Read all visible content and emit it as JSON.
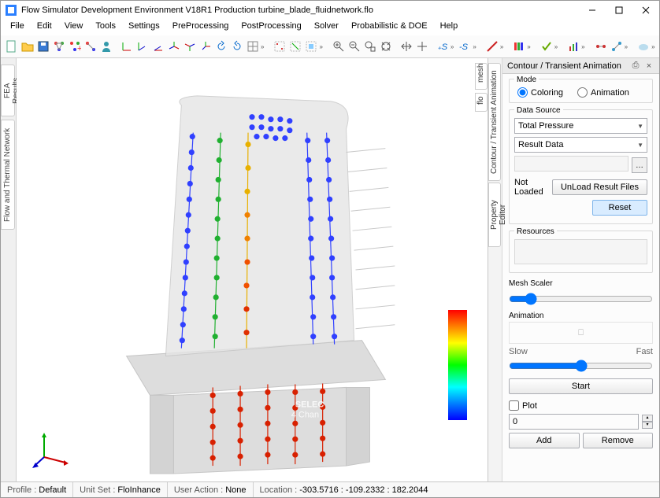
{
  "window": {
    "title": "Flow Simulator Development Environment V18R1 Production turbine_blade_fluidnetwork.flo"
  },
  "menu": [
    "File",
    "Edit",
    "View",
    "Tools",
    "Settings",
    "PreProcessing",
    "PostProcessing",
    "Solver",
    "Probabilistic & DOE",
    "Help"
  ],
  "left_tabs": {
    "fea": "FEA Results",
    "flow": "Flow and Thermal Network"
  },
  "right_panel": {
    "title": "Contour / Transient Animation",
    "vtab1": "Contour / Transient Animation",
    "vtab2": "mesh",
    "vtab3": "flo",
    "vtab4": "Property Editor",
    "mode": {
      "label": "Mode",
      "opt1": "Coloring",
      "opt2": "Animation"
    },
    "data_source": {
      "label": "Data Source",
      "combo1": "Total Pressure",
      "combo2": "Result Data",
      "status": "Not Loaded",
      "unload_btn": "UnLoad Result Files",
      "reset_btn": "Reset"
    },
    "resources": {
      "label": "Resources"
    },
    "mesh_scaler": {
      "label": "Mesh Scaler"
    },
    "animation": {
      "label": "Animation",
      "slow": "Slow",
      "fast": "Fast",
      "start_btn": "Start"
    },
    "plot": {
      "label": "Plot",
      "value": "0",
      "add_btn": "Add",
      "remove_btn": "Remove"
    }
  },
  "viewport": {
    "overlay_text1": "SELEC",
    "overlay_text2": "4 Chan"
  },
  "status": {
    "profile_label": "Profile :",
    "profile_val": "Default",
    "unitset_label": "Unit Set :",
    "unitset_val": "FloInhance",
    "action_label": "User Action :",
    "action_val": "None",
    "location_label": "Location :",
    "location_val": "-303.5716 : -109.2332 : 182.2044"
  }
}
